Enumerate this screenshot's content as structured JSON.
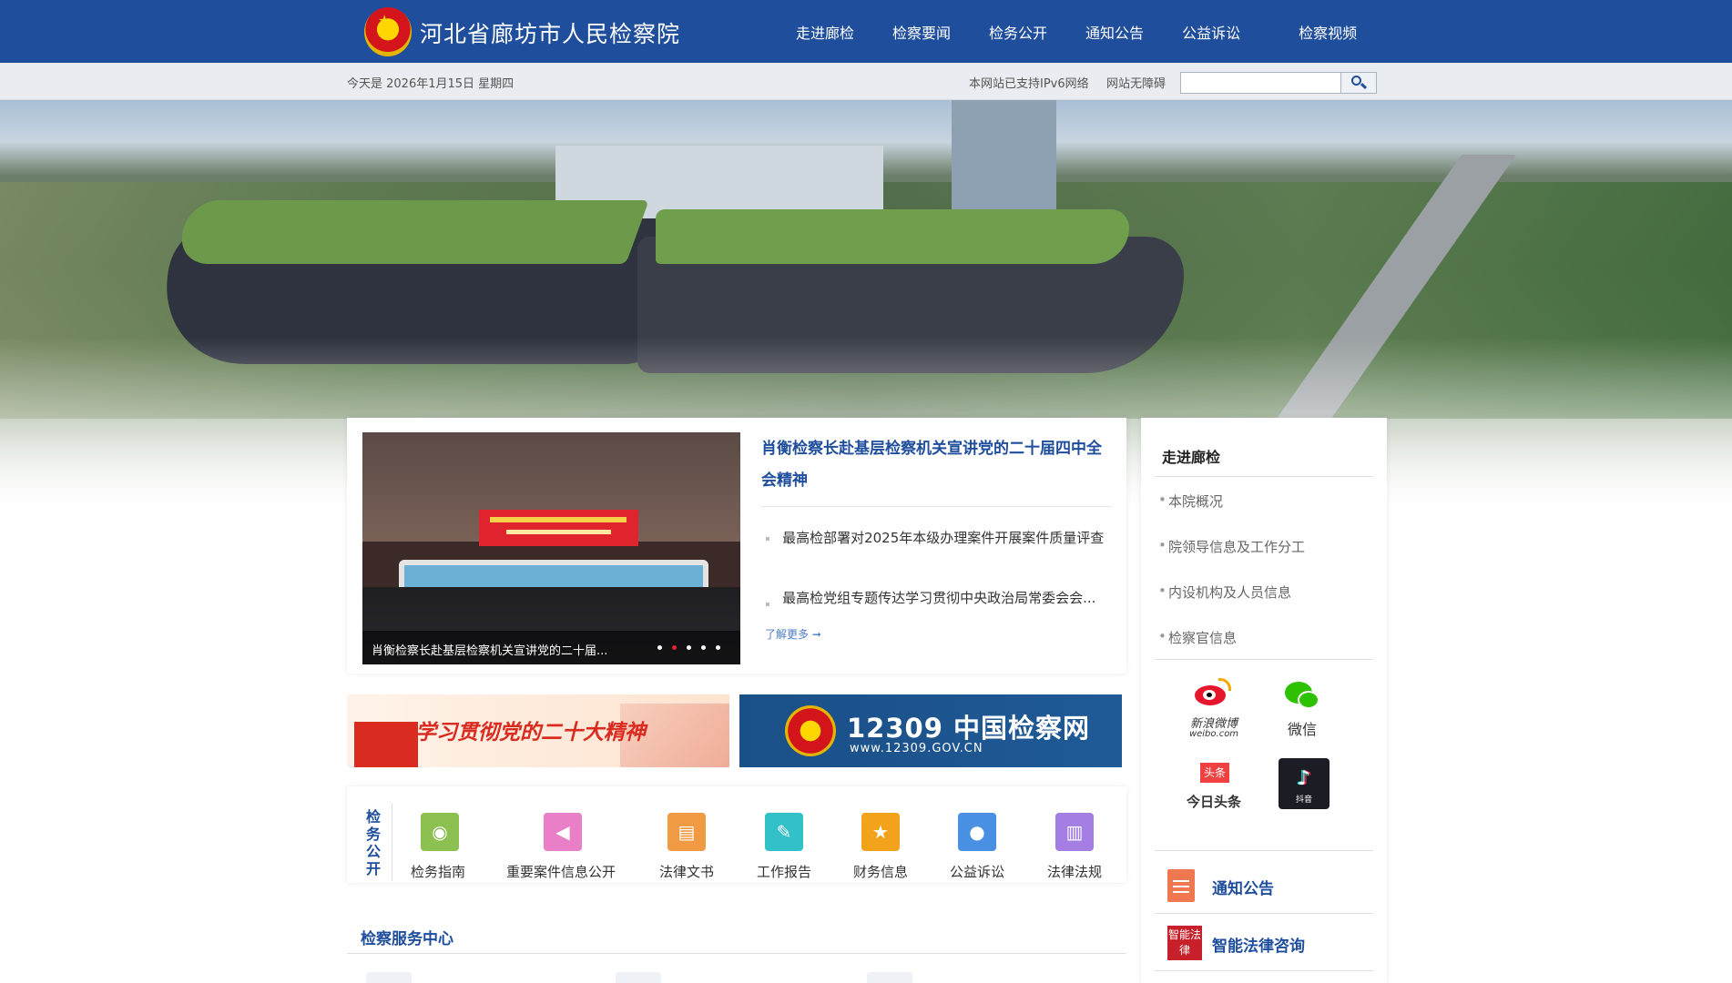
{
  "header": {
    "site_title": "河北省廊坊市人民检察院",
    "nav": [
      "走进廊检",
      "检察要闻",
      "检务公开",
      "通知公告",
      "公益诉讼",
      "检察视频"
    ]
  },
  "subbar": {
    "date": "今天是 2026年1月15日 星期四",
    "ipv6": "本网站已支持IPv6网络",
    "accessibility": "网站无障碍",
    "search_value": ""
  },
  "news": {
    "headline": "肖衡检察长赴基层检察机关宣讲党的二十届四中全会精神",
    "items": [
      "最高检部署对2025年本级办理案件开展案件质量评查",
      "最高检党组专题传达学习贯彻中央政治局常委会会..."
    ],
    "more": "了解更多 ➞",
    "slide_caption": "肖衡检察长赴基层检察机关宣讲党的二十届...",
    "slide_count": 5,
    "active_slide": 2
  },
  "banners": {
    "study": "学习贯彻党的二十大精神",
    "net_title": "12309 中国检察网",
    "net_url": "www.12309.GOV.CN"
  },
  "services": {
    "label": "检务公开",
    "items": [
      {
        "label": "检务指南",
        "icon": "eye-icon",
        "color": "#8cc152",
        "glyph": "◉"
      },
      {
        "label": "重要案件信息公开",
        "icon": "megaphone-icon",
        "color": "#e87fc7",
        "glyph": "◀"
      },
      {
        "label": "法律文书",
        "icon": "document-icon",
        "color": "#f09b43",
        "glyph": "▤"
      },
      {
        "label": "工作报告",
        "icon": "edit-icon",
        "color": "#32c0c9",
        "glyph": "✎"
      },
      {
        "label": "财务信息",
        "icon": "star-icon",
        "color": "#f3a31b",
        "glyph": "★"
      },
      {
        "label": "公益诉讼",
        "icon": "user-icon",
        "color": "#4a90e2",
        "glyph": "●"
      },
      {
        "label": "法律法规",
        "icon": "books-icon",
        "color": "#a57ee3",
        "glyph": "▥"
      }
    ]
  },
  "service_center": {
    "title": "检察服务中心"
  },
  "sidebar": {
    "title": "走进廊检",
    "links": [
      "本院概况",
      "院领导信息及工作分工",
      "内设机构及人员信息",
      "检察官信息"
    ],
    "social": {
      "weibo": "新浪微博",
      "weibo_domain": "weibo.com",
      "wechat": "微信",
      "toutiao_badge": "头条",
      "toutiao": "今日头条",
      "douyin": "抖音"
    },
    "notice": "通知公告",
    "law_consult": "智能法律咨询",
    "law_icon_text": "智能法律"
  },
  "colors": {
    "brand_blue": "#1f4e9d",
    "accent_red": "#e0242e"
  }
}
